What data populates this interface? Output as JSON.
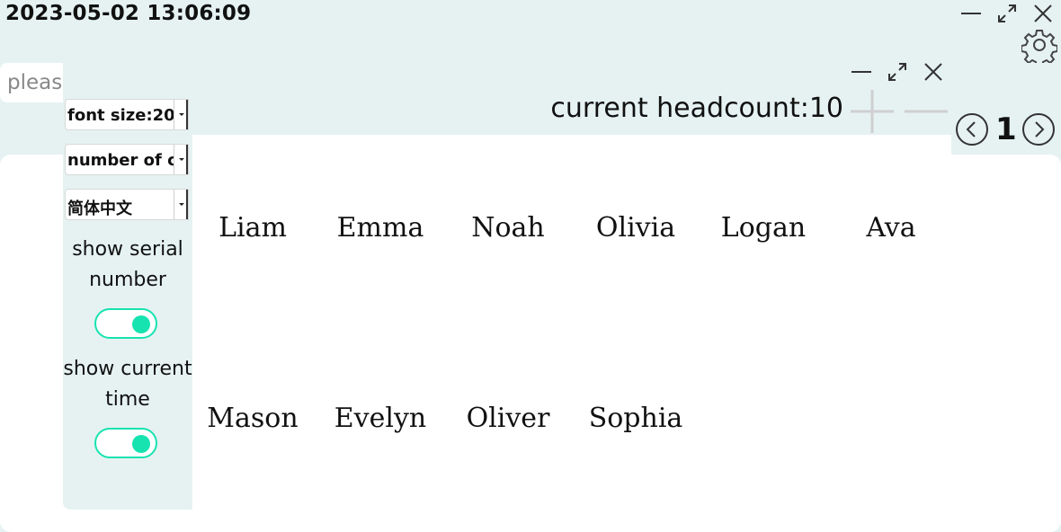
{
  "clock": {
    "datetime": "2023-05-02 13:06:09"
  },
  "window_controls": {
    "minimize_icon": "minimize-icon",
    "maximize_icon": "maximize-icon",
    "close_icon": "close-icon",
    "settings_icon": "gear-icon"
  },
  "search": {
    "placeholder": "please"
  },
  "settings_panel": {
    "font_size_select": "font size:20",
    "number_select": "number of columns",
    "language_select": "简体中文",
    "show_serial_label": "show serial number",
    "show_serial_enabled": true,
    "show_time_label": "show current time",
    "show_time_enabled": true
  },
  "headcount": {
    "label": "current headcount:",
    "value": "10"
  },
  "pager": {
    "page": "1"
  },
  "names": [
    "Liam",
    "Emma",
    "Noah",
    "Olivia",
    "Logan",
    "Ava",
    "Mason",
    "Evelyn",
    "Oliver",
    "Sophia"
  ],
  "colors": {
    "background": "#e6f2f2",
    "toggle_accent": "#17e3b0"
  }
}
